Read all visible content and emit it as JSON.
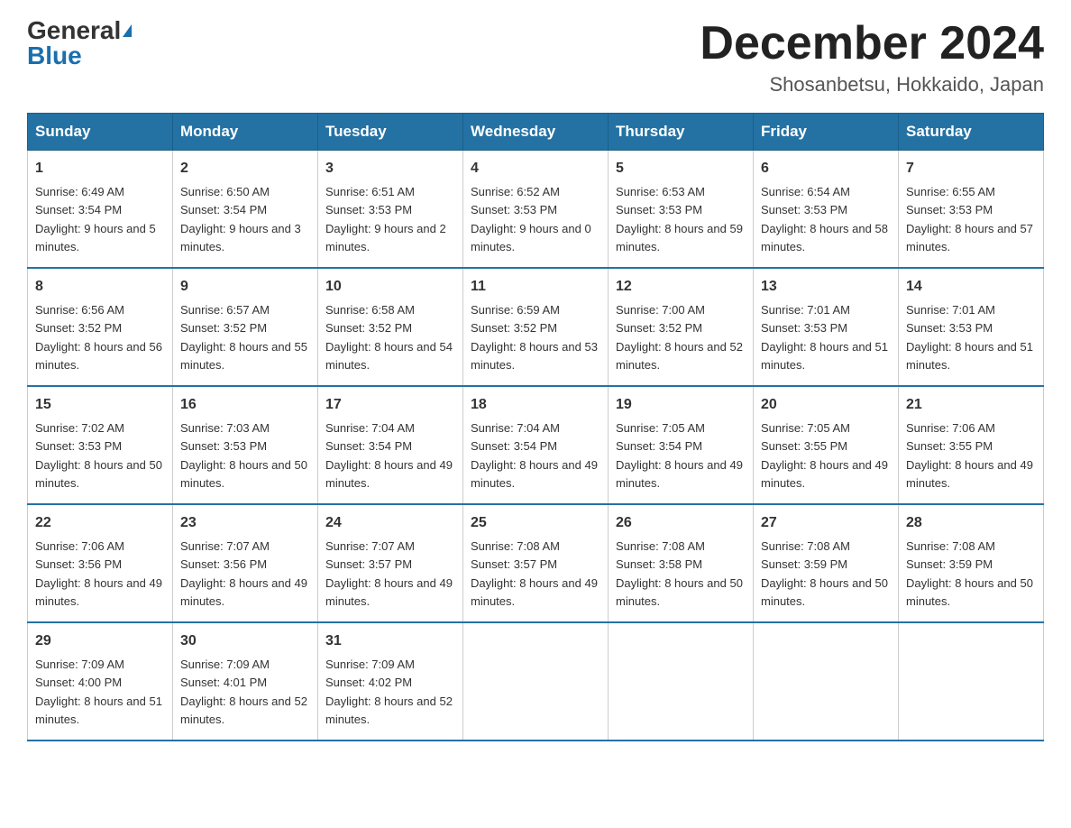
{
  "logo": {
    "general": "General",
    "blue": "Blue"
  },
  "title": {
    "month": "December 2024",
    "location": "Shosanbetsu, Hokkaido, Japan"
  },
  "weekdays": [
    "Sunday",
    "Monday",
    "Tuesday",
    "Wednesday",
    "Thursday",
    "Friday",
    "Saturday"
  ],
  "weeks": [
    [
      {
        "day": "1",
        "sunrise": "Sunrise: 6:49 AM",
        "sunset": "Sunset: 3:54 PM",
        "daylight": "Daylight: 9 hours and 5 minutes."
      },
      {
        "day": "2",
        "sunrise": "Sunrise: 6:50 AM",
        "sunset": "Sunset: 3:54 PM",
        "daylight": "Daylight: 9 hours and 3 minutes."
      },
      {
        "day": "3",
        "sunrise": "Sunrise: 6:51 AM",
        "sunset": "Sunset: 3:53 PM",
        "daylight": "Daylight: 9 hours and 2 minutes."
      },
      {
        "day": "4",
        "sunrise": "Sunrise: 6:52 AM",
        "sunset": "Sunset: 3:53 PM",
        "daylight": "Daylight: 9 hours and 0 minutes."
      },
      {
        "day": "5",
        "sunrise": "Sunrise: 6:53 AM",
        "sunset": "Sunset: 3:53 PM",
        "daylight": "Daylight: 8 hours and 59 minutes."
      },
      {
        "day": "6",
        "sunrise": "Sunrise: 6:54 AM",
        "sunset": "Sunset: 3:53 PM",
        "daylight": "Daylight: 8 hours and 58 minutes."
      },
      {
        "day": "7",
        "sunrise": "Sunrise: 6:55 AM",
        "sunset": "Sunset: 3:53 PM",
        "daylight": "Daylight: 8 hours and 57 minutes."
      }
    ],
    [
      {
        "day": "8",
        "sunrise": "Sunrise: 6:56 AM",
        "sunset": "Sunset: 3:52 PM",
        "daylight": "Daylight: 8 hours and 56 minutes."
      },
      {
        "day": "9",
        "sunrise": "Sunrise: 6:57 AM",
        "sunset": "Sunset: 3:52 PM",
        "daylight": "Daylight: 8 hours and 55 minutes."
      },
      {
        "day": "10",
        "sunrise": "Sunrise: 6:58 AM",
        "sunset": "Sunset: 3:52 PM",
        "daylight": "Daylight: 8 hours and 54 minutes."
      },
      {
        "day": "11",
        "sunrise": "Sunrise: 6:59 AM",
        "sunset": "Sunset: 3:52 PM",
        "daylight": "Daylight: 8 hours and 53 minutes."
      },
      {
        "day": "12",
        "sunrise": "Sunrise: 7:00 AM",
        "sunset": "Sunset: 3:52 PM",
        "daylight": "Daylight: 8 hours and 52 minutes."
      },
      {
        "day": "13",
        "sunrise": "Sunrise: 7:01 AM",
        "sunset": "Sunset: 3:53 PM",
        "daylight": "Daylight: 8 hours and 51 minutes."
      },
      {
        "day": "14",
        "sunrise": "Sunrise: 7:01 AM",
        "sunset": "Sunset: 3:53 PM",
        "daylight": "Daylight: 8 hours and 51 minutes."
      }
    ],
    [
      {
        "day": "15",
        "sunrise": "Sunrise: 7:02 AM",
        "sunset": "Sunset: 3:53 PM",
        "daylight": "Daylight: 8 hours and 50 minutes."
      },
      {
        "day": "16",
        "sunrise": "Sunrise: 7:03 AM",
        "sunset": "Sunset: 3:53 PM",
        "daylight": "Daylight: 8 hours and 50 minutes."
      },
      {
        "day": "17",
        "sunrise": "Sunrise: 7:04 AM",
        "sunset": "Sunset: 3:54 PM",
        "daylight": "Daylight: 8 hours and 49 minutes."
      },
      {
        "day": "18",
        "sunrise": "Sunrise: 7:04 AM",
        "sunset": "Sunset: 3:54 PM",
        "daylight": "Daylight: 8 hours and 49 minutes."
      },
      {
        "day": "19",
        "sunrise": "Sunrise: 7:05 AM",
        "sunset": "Sunset: 3:54 PM",
        "daylight": "Daylight: 8 hours and 49 minutes."
      },
      {
        "day": "20",
        "sunrise": "Sunrise: 7:05 AM",
        "sunset": "Sunset: 3:55 PM",
        "daylight": "Daylight: 8 hours and 49 minutes."
      },
      {
        "day": "21",
        "sunrise": "Sunrise: 7:06 AM",
        "sunset": "Sunset: 3:55 PM",
        "daylight": "Daylight: 8 hours and 49 minutes."
      }
    ],
    [
      {
        "day": "22",
        "sunrise": "Sunrise: 7:06 AM",
        "sunset": "Sunset: 3:56 PM",
        "daylight": "Daylight: 8 hours and 49 minutes."
      },
      {
        "day": "23",
        "sunrise": "Sunrise: 7:07 AM",
        "sunset": "Sunset: 3:56 PM",
        "daylight": "Daylight: 8 hours and 49 minutes."
      },
      {
        "day": "24",
        "sunrise": "Sunrise: 7:07 AM",
        "sunset": "Sunset: 3:57 PM",
        "daylight": "Daylight: 8 hours and 49 minutes."
      },
      {
        "day": "25",
        "sunrise": "Sunrise: 7:08 AM",
        "sunset": "Sunset: 3:57 PM",
        "daylight": "Daylight: 8 hours and 49 minutes."
      },
      {
        "day": "26",
        "sunrise": "Sunrise: 7:08 AM",
        "sunset": "Sunset: 3:58 PM",
        "daylight": "Daylight: 8 hours and 50 minutes."
      },
      {
        "day": "27",
        "sunrise": "Sunrise: 7:08 AM",
        "sunset": "Sunset: 3:59 PM",
        "daylight": "Daylight: 8 hours and 50 minutes."
      },
      {
        "day": "28",
        "sunrise": "Sunrise: 7:08 AM",
        "sunset": "Sunset: 3:59 PM",
        "daylight": "Daylight: 8 hours and 50 minutes."
      }
    ],
    [
      {
        "day": "29",
        "sunrise": "Sunrise: 7:09 AM",
        "sunset": "Sunset: 4:00 PM",
        "daylight": "Daylight: 8 hours and 51 minutes."
      },
      {
        "day": "30",
        "sunrise": "Sunrise: 7:09 AM",
        "sunset": "Sunset: 4:01 PM",
        "daylight": "Daylight: 8 hours and 52 minutes."
      },
      {
        "day": "31",
        "sunrise": "Sunrise: 7:09 AM",
        "sunset": "Sunset: 4:02 PM",
        "daylight": "Daylight: 8 hours and 52 minutes."
      },
      null,
      null,
      null,
      null
    ]
  ]
}
